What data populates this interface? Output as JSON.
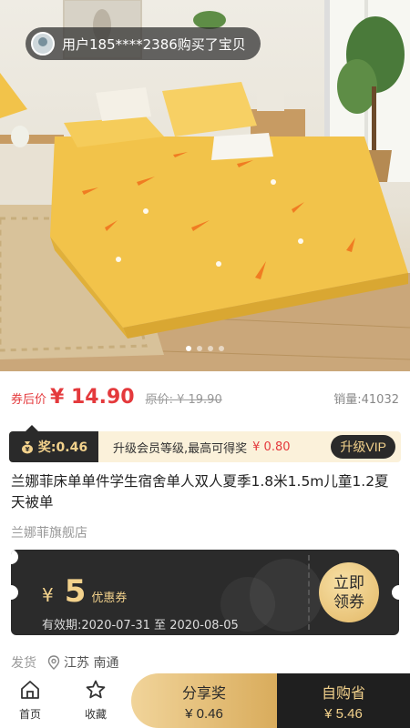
{
  "hero": {
    "purchase_toast": "用户185****2386购买了宝贝",
    "carousel_count": 4
  },
  "price": {
    "label": "券后价",
    "value": "¥ 14.90",
    "original": "原价: ¥ 19.90",
    "sales": "销量:41032"
  },
  "reward": {
    "tag": "奖:0.46",
    "text": "升级会员等级,最高可得奖",
    "amount": "¥ 0.80",
    "vip_button": "升级VIP"
  },
  "product": {
    "title": "兰娜菲床单单件学生宿舍单人双人夏季1.8米1.5m儿童1.2夏天被单",
    "shop": "兰娜菲旗舰店"
  },
  "coupon": {
    "currency": "¥",
    "amount": "5",
    "label": "优惠券",
    "validity": "有效期:2020-07-31 至 2020-08-05",
    "claim_line1": "立即",
    "claim_line2": "领券"
  },
  "shipping": {
    "label": "发货",
    "location": "江苏 南通"
  },
  "bottom_bar": {
    "home": "首页",
    "favorite": "收藏",
    "share_title": "分享奖",
    "share_amount": "¥ 0.46",
    "buy_title": "自购省",
    "buy_amount": "¥ 5.46"
  },
  "colors": {
    "accent_red": "#e4393c",
    "gold": "#f3d28c",
    "dark": "#2a2a2a",
    "bed_yellow": "#f2c34a"
  }
}
